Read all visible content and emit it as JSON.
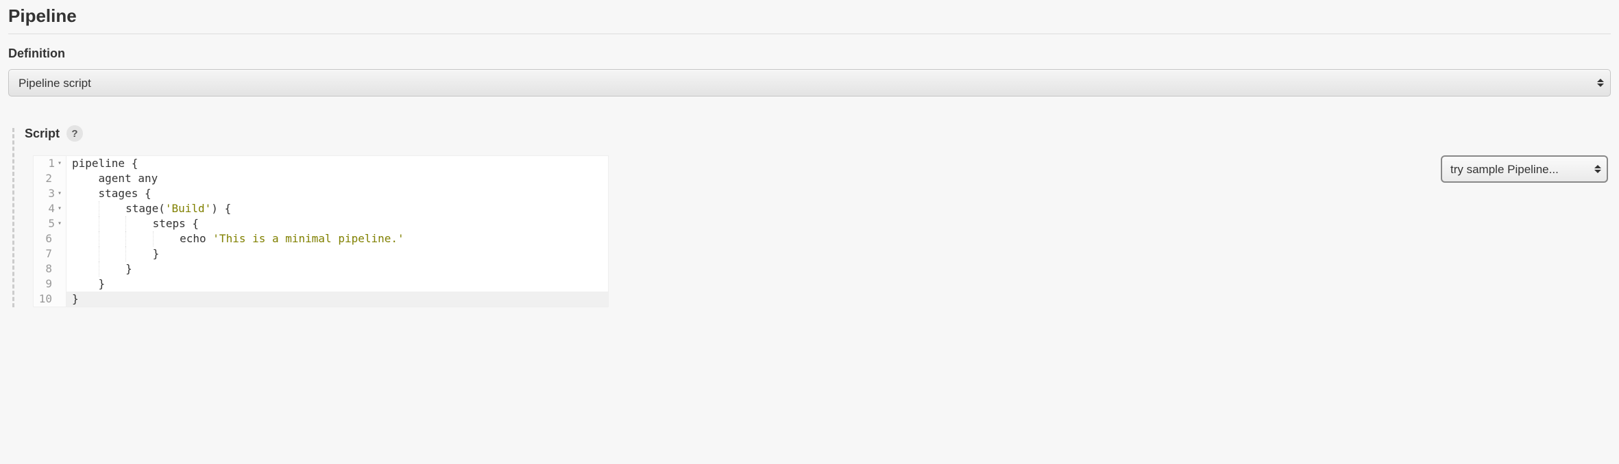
{
  "section": {
    "title": "Pipeline"
  },
  "definition": {
    "label": "Definition",
    "selected": "Pipeline script"
  },
  "script": {
    "label": "Script",
    "help_symbol": "?",
    "sample_selected": "try sample Pipeline...",
    "lines": [
      {
        "num": "1",
        "foldable": true,
        "highlighted": false,
        "indent": "",
        "tokens": [
          {
            "t": "pipeline {",
            "c": "plain"
          }
        ]
      },
      {
        "num": "2",
        "foldable": false,
        "highlighted": false,
        "indent": "    ",
        "tokens": [
          {
            "t": "agent any",
            "c": "plain"
          }
        ]
      },
      {
        "num": "3",
        "foldable": true,
        "highlighted": false,
        "indent": "    ",
        "tokens": [
          {
            "t": "stages {",
            "c": "plain"
          }
        ]
      },
      {
        "num": "4",
        "foldable": true,
        "highlighted": false,
        "indent": "        ",
        "tokens": [
          {
            "t": "stage(",
            "c": "plain"
          },
          {
            "t": "'Build'",
            "c": "str"
          },
          {
            "t": ") {",
            "c": "plain"
          }
        ]
      },
      {
        "num": "5",
        "foldable": true,
        "highlighted": false,
        "indent": "            ",
        "tokens": [
          {
            "t": "steps {",
            "c": "plain"
          }
        ]
      },
      {
        "num": "6",
        "foldable": false,
        "highlighted": false,
        "indent": "                ",
        "tokens": [
          {
            "t": "echo ",
            "c": "plain"
          },
          {
            "t": "'This is a minimal pipeline.'",
            "c": "str"
          }
        ]
      },
      {
        "num": "7",
        "foldable": false,
        "highlighted": false,
        "indent": "            ",
        "tokens": [
          {
            "t": "}",
            "c": "plain"
          }
        ]
      },
      {
        "num": "8",
        "foldable": false,
        "highlighted": false,
        "indent": "        ",
        "tokens": [
          {
            "t": "}",
            "c": "plain"
          }
        ]
      },
      {
        "num": "9",
        "foldable": false,
        "highlighted": false,
        "indent": "    ",
        "tokens": [
          {
            "t": "}",
            "c": "plain"
          }
        ]
      },
      {
        "num": "10",
        "foldable": false,
        "highlighted": true,
        "indent": "",
        "tokens": [
          {
            "t": "}",
            "c": "plain"
          }
        ]
      }
    ]
  }
}
